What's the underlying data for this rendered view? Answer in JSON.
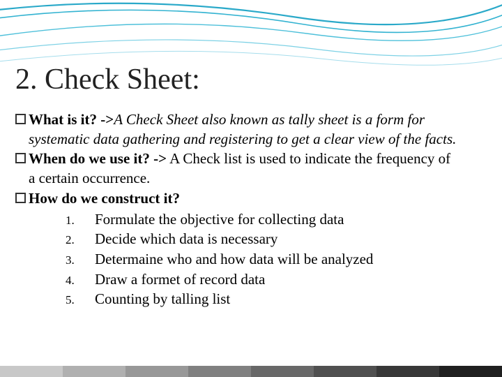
{
  "slide": {
    "title": "2. Check Sheet:",
    "bullets": [
      {
        "label": "What is it? ->",
        "text": "A Check Sheet also known as tally sheet  is a form for systematic data gathering and registering to get a clear view of the facts.",
        "italic": true
      },
      {
        "label": "When do we use it? ->",
        "text": " A Check list is used to indicate the frequency of a certain occurrence.",
        "italic": false
      },
      {
        "label": "How do we construct it?",
        "text": "",
        "italic": false
      }
    ],
    "steps": [
      {
        "n": "1.",
        "text": "Formulate the objective for collecting data"
      },
      {
        "n": "2.",
        "text": "Decide which data is necessary"
      },
      {
        "n": "3.",
        "text": "Determaine who and how data will be analyzed"
      },
      {
        "n": "4.",
        "text": "Draw a formet of record data"
      },
      {
        "n": "5.",
        "text": "Counting by talling list"
      }
    ]
  }
}
